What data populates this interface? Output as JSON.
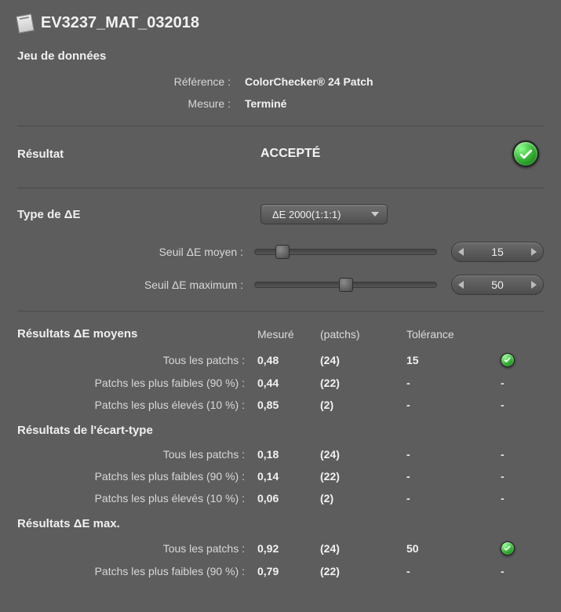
{
  "title": "EV3237_MAT_032018",
  "dataset": {
    "heading": "Jeu de données",
    "reference_label": "Référence :",
    "reference_value": "ColorChecker® 24 Patch",
    "measure_label": "Mesure :",
    "measure_value": "Terminé"
  },
  "result": {
    "label": "Résultat",
    "value": "ACCEPTÉ",
    "status": "ok"
  },
  "delta": {
    "label": "Type de ΔE",
    "selected": "ΔE 2000(1:1:1)",
    "thresholds": {
      "avg_label": "Seuil ΔE moyen :",
      "avg_value": "15",
      "avg_pos_pct": 15,
      "max_label": "Seuil ΔE maximum :",
      "max_value": "50",
      "max_pos_pct": 50
    }
  },
  "results": {
    "columns": {
      "measure": "Mesuré",
      "patches_suffix": "(patchs)",
      "tolerance": "Tolérance"
    },
    "sections": [
      {
        "heading": "Résultats ΔE moyens",
        "rows": [
          {
            "label": "Tous les patchs :",
            "measure": "0,48",
            "patches": "(24)",
            "tolerance": "15",
            "status": "ok"
          },
          {
            "label": "Patchs les plus faibles (90 %) :",
            "measure": "0,44",
            "patches": "(22)",
            "tolerance": "-",
            "status": "-"
          },
          {
            "label": "Patchs les plus élevés (10 %) :",
            "measure": "0,85",
            "patches": "(2)",
            "tolerance": "-",
            "status": "-"
          }
        ]
      },
      {
        "heading": "Résultats de l'écart-type",
        "rows": [
          {
            "label": "Tous les patchs :",
            "measure": "0,18",
            "patches": "(24)",
            "tolerance": "-",
            "status": "-"
          },
          {
            "label": "Patchs les plus faibles (90 %) :",
            "measure": "0,14",
            "patches": "(22)",
            "tolerance": "-",
            "status": "-"
          },
          {
            "label": "Patchs les plus élevés (10 %) :",
            "measure": "0,06",
            "patches": "(2)",
            "tolerance": "-",
            "status": "-"
          }
        ]
      },
      {
        "heading": "Résultats ΔE max.",
        "rows": [
          {
            "label": "Tous les patchs :",
            "measure": "0,92",
            "patches": "(24)",
            "tolerance": "50",
            "status": "ok"
          },
          {
            "label": "Patchs les plus faibles (90 %) :",
            "measure": "0,79",
            "patches": "(22)",
            "tolerance": "-",
            "status": "-"
          }
        ]
      }
    ]
  }
}
